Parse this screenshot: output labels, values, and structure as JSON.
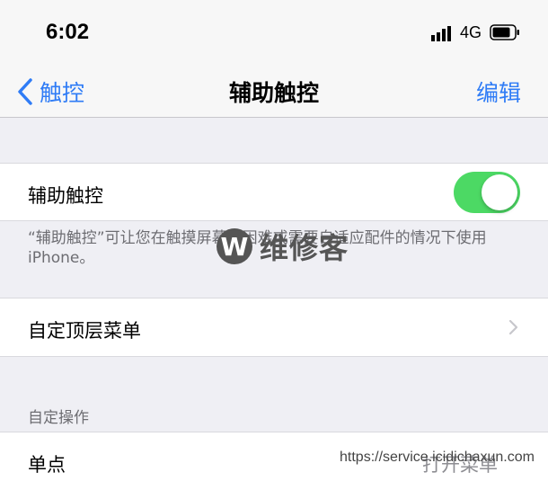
{
  "status_bar": {
    "time": "6:02",
    "network": "4G"
  },
  "nav": {
    "back_label": "触控",
    "title": "辅助触控",
    "edit_label": "编辑"
  },
  "assistive_touch": {
    "label": "辅助触控",
    "enabled": true,
    "description": "“辅助触控”可让您在触摸屏幕有困难或需要自适应配件的情况下使用iPhone。"
  },
  "top_menu": {
    "label": "自定顶层菜单"
  },
  "custom_actions": {
    "header": "自定操作",
    "single_tap": {
      "label": "单点",
      "value": "打开菜单"
    }
  },
  "watermark": {
    "logo_letter": "W",
    "text": "维修客",
    "url": "https://service.icidichaxun.com"
  },
  "colors": {
    "accent": "#2f7cf6",
    "toggle_on": "#4cd964"
  }
}
